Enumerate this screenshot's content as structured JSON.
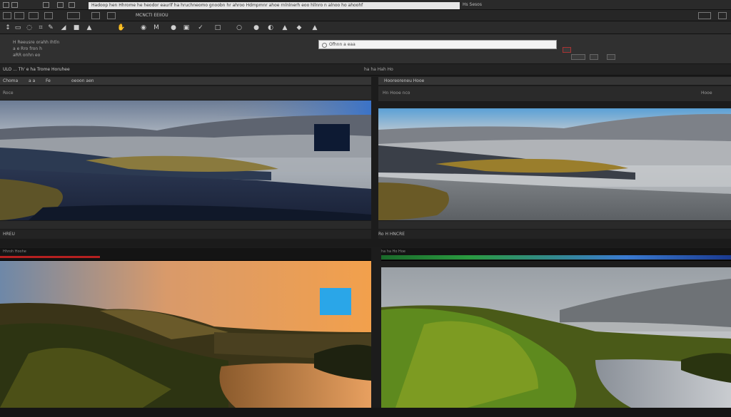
{
  "titlebar": {
    "url_text": "Hadoop hen Hhrome he heodor eaurlf ha hruchneomo gnoobn hr ahroo Hdmpmnr ahoe rnlnlnerh eoo hllnro n alnoo ho ahoohf",
    "right_text": "Hs  Sesos"
  },
  "menubar": {
    "title": "MCNCTI EEIIOU"
  },
  "options": {
    "line1": "H  Reeusre orahh Ihtln",
    "line2": "a  e Rro  fron  h",
    "line3": "aRR onhn eo",
    "search_placeholder": "Ofhnn a eaa"
  },
  "strip": {
    "left_label": "ULO ... Th'  e ha Trome Horuhee",
    "right_label": "ha ha  Hah  Ho"
  },
  "top_left": {
    "header_a": "Choma",
    "header_b": "a a",
    "header_c": "Fe",
    "header_d": "oeoon aen",
    "sub_label": "Roce"
  },
  "top_right": {
    "header": "Hooreoreneu Hooe",
    "sub_label": "Hn Hooe nco",
    "tab_right": "Hooe"
  },
  "bottom_footer_left": {
    "label": "HREU"
  },
  "bottom_footer_right": {
    "label": "Ro  H  HNCRE"
  },
  "lower_left": {
    "label": "Hhroh Hoohe"
  },
  "lower_right": {
    "label": "ha ha  Ho  Hoe"
  },
  "colors": {
    "accent_blue": "#2aa6e8",
    "selection_dark": "#0d1a33",
    "panel_bg": "#303030"
  }
}
